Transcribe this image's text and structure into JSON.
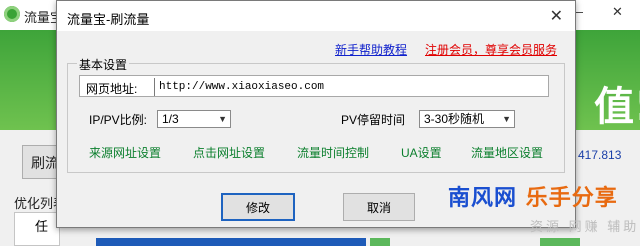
{
  "background_app": {
    "title": "流量宝",
    "minimize": "—",
    "close": "✕",
    "banner_text": "值!",
    "side_button": "刷流",
    "count_text": "417.813",
    "optimize_label": "优化列表",
    "table_head": "任务类"
  },
  "dialog": {
    "title": "流量宝-刷流量",
    "close": "✕",
    "help_link": "新手帮助教程",
    "register_link": "注册会员，尊享会员服务",
    "group_title": "基本设置",
    "url_label": "网页地址:",
    "url_value": "http://www.xiaoxiaseo.com",
    "ratio_label": "IP/PV比例:",
    "ratio_value": "1/3",
    "stay_label": "PV停留时间",
    "stay_value": "3-30秒随机",
    "links": {
      "source": "来源网址设置",
      "click": "点击网址设置",
      "time": "流量时间控制",
      "ua": "UA设置",
      "region": "流量地区设置"
    },
    "modify_button": "修改",
    "cancel_button": "取消"
  },
  "watermark": {
    "part1": "南风网",
    "part2": "乐手分享",
    "sub": "资源 网赚 辅助"
  }
}
